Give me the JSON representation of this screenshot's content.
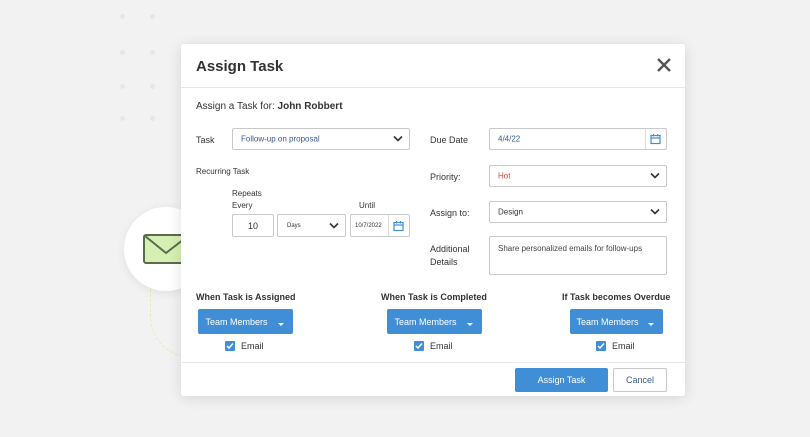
{
  "dialog": {
    "title": "Assign Task",
    "assign_prefix": "Assign a Task for:",
    "assignee": "John Robbert"
  },
  "left": {
    "task_label": "Task",
    "task_value": "Follow-up on proposal",
    "recurring_label": "Recurring Task",
    "repeats_label": "Repeats",
    "every_label": "Every",
    "until_label": "Until",
    "every_value": "10",
    "unit_value": "Days",
    "until_value": "10/7/2022"
  },
  "right": {
    "due_label": "Due Date",
    "due_value": "4/4/22",
    "priority_label": "Priority:",
    "priority_value": "Hot",
    "assign_to_label": "Assign to:",
    "assign_to_value": "Design",
    "details_label_1": "Additional",
    "details_label_2": "Details",
    "details_value": "Share personalized emails for follow-ups"
  },
  "notifications": [
    {
      "heading": "When Task is Assigned",
      "button": "Team Members",
      "check_label": "Email"
    },
    {
      "heading": "When Task is Completed",
      "button": "Team Members",
      "check_label": "Email"
    },
    {
      "heading": "If Task becomes Overdue",
      "button": "Team Members",
      "check_label": "Email"
    }
  ],
  "footer": {
    "assign_button": "Assign Task",
    "cancel_button": "Cancel"
  },
  "colors": {
    "accent": "#3f8ed6",
    "priority_hot": "#e0442f",
    "envelope": "#d6f0b3"
  },
  "icons": [
    "close-icon",
    "chevron-down-icon",
    "calendar-icon",
    "checkmark-icon",
    "envelope-bell-icon"
  ]
}
